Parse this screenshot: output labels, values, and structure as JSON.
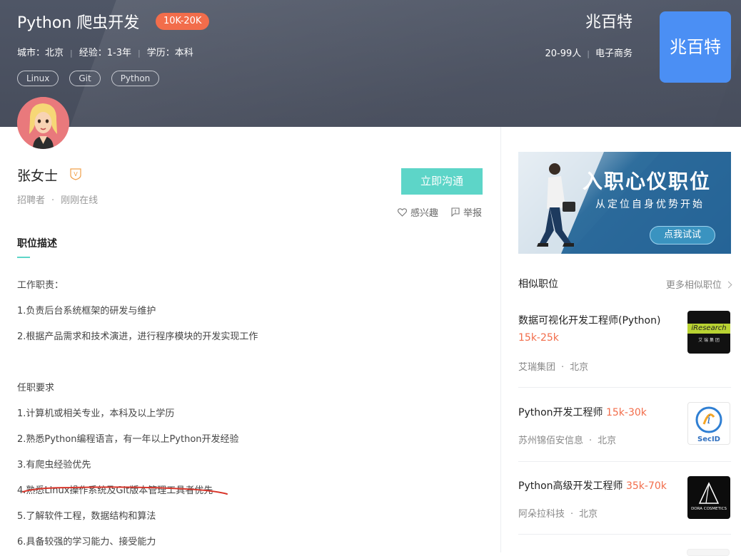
{
  "job": {
    "title": "Python 爬虫开发",
    "salary": "10K-20K",
    "city": "城市：北京",
    "experience": "经验：1-3年",
    "education": "学历：本科",
    "tags": [
      "Linux",
      "Git",
      "Python"
    ]
  },
  "company": {
    "name": "兆百特",
    "size": "20-99人",
    "industry": "电子商务",
    "logo_text": "兆百特",
    "logo_color": "#4b8ff4"
  },
  "recruiter": {
    "name": "张女士",
    "verify_badge": "V",
    "role": "招聘者",
    "separator": "·",
    "status": "刚刚在线"
  },
  "actions": {
    "chat": "立即沟通",
    "interest": "感兴趣",
    "report": "举报"
  },
  "description": {
    "section_title": "职位描述",
    "duties_heading": "工作职责：",
    "duties": [
      "1.负责后台系统框架的研发与维护",
      "2.根据产品需求和技术演进，进行程序模块的开发实现工作"
    ],
    "requirements_heading": "任职要求",
    "requirements": [
      "1.计算机或相关专业，本科及以上学历",
      "2.熟悉Python编程语言，有一年以上Python开发经验",
      "3.有爬虫经验优先",
      "4.熟悉Linux操作系统及Git版本管理工具者优先",
      "5.了解软件工程，数据结构和算法",
      "6.具备较强的学习能力、接受能力"
    ]
  },
  "banner": {
    "title": "入职心仪职位",
    "subtitle": "从定位自身优势开始",
    "button": "点我试试"
  },
  "similar": {
    "title": "相似职位",
    "more": "更多相似职位",
    "jobs": [
      {
        "title": "数据可视化开发工程师(Python)",
        "salary": "15k-25k",
        "company": "艾瑞集团",
        "city": "北京",
        "logo_text": "iResearch",
        "logo_sub": "艾 瑞 集 团"
      },
      {
        "title": "Python开发工程师",
        "salary": "15k-30k",
        "company": "苏州锦佰安信息",
        "city": "北京",
        "logo_text": "SecID"
      },
      {
        "title": "Python高级开发工程师",
        "salary": "35k-70k",
        "company": "阿朵拉科技",
        "city": "北京",
        "logo_text": "DORA COSMETICS"
      }
    ]
  },
  "colors": {
    "accent": "#5dd5c8",
    "salary": "#f26d4b",
    "header_bg": "#4f5666"
  }
}
